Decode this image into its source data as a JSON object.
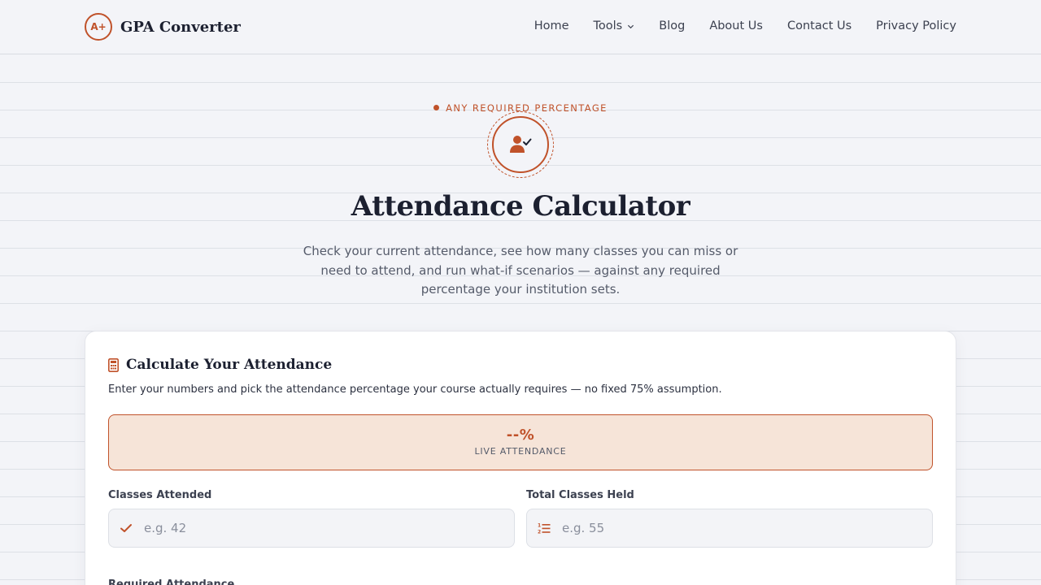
{
  "brand": {
    "mark": "A+",
    "name": "GPA Converter",
    "accent_color": "#c0522a"
  },
  "nav": {
    "items": [
      {
        "label": "Home"
      },
      {
        "label": "Tools",
        "has_dropdown": true,
        "icon": "chevron-down-icon"
      },
      {
        "label": "Blog"
      },
      {
        "label": "About Us"
      },
      {
        "label": "Contact Us"
      },
      {
        "label": "Privacy Policy"
      }
    ]
  },
  "hero": {
    "eyebrow": "ANY REQUIRED PERCENTAGE",
    "icon": "user-check-icon",
    "title": "Attendance Calculator",
    "subtitle": "Check your current attendance, see how many classes you can miss or need to attend, and run what-if scenarios — against any required percentage your institution sets."
  },
  "card": {
    "icon": "calculator-icon",
    "title": "Calculate Your Attendance",
    "description": "Enter your numbers and pick the attendance percentage your course actually requires — no fixed 75% assumption.",
    "live": {
      "value": "--%",
      "label": "LIVE ATTENDANCE"
    },
    "fields": [
      {
        "label": "Classes Attended",
        "placeholder": "e.g. 42",
        "value": "",
        "icon": "check-icon"
      },
      {
        "label": "Total Classes Held",
        "placeholder": "e.g. 55",
        "value": "",
        "icon": "numbered-list-icon"
      }
    ],
    "next_field_label": "Required Attendance"
  }
}
